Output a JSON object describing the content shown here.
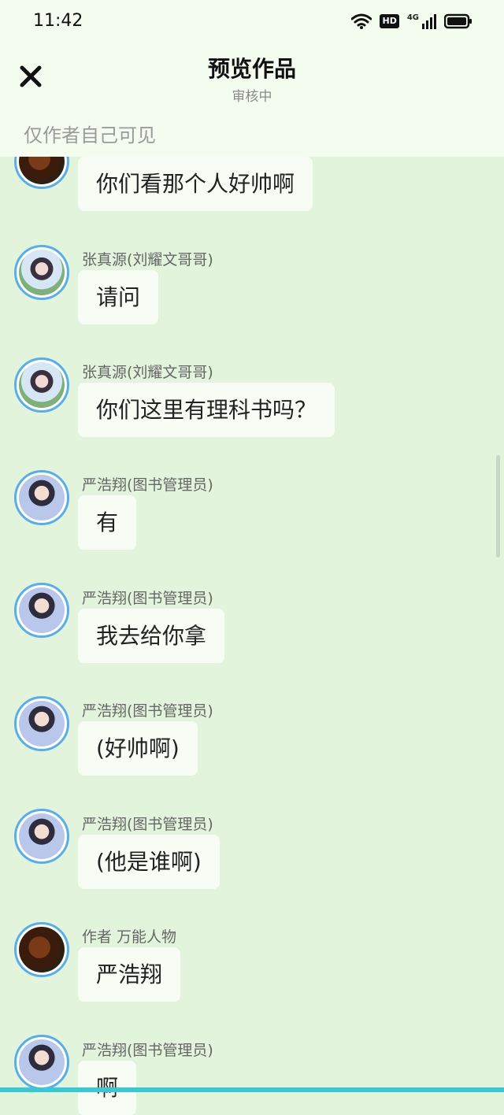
{
  "status_bar": {
    "time": "11:42",
    "icons": [
      "wifi-icon",
      "hd-icon",
      "signal-4g-icon",
      "battery-icon"
    ],
    "hd_label": "HD",
    "network_label": "4G"
  },
  "header": {
    "title": "预览作品",
    "subtitle": "审核中",
    "close_icon": "close-icon",
    "visibility_note": "仅作者自己可见"
  },
  "messages": [
    {
      "name": "",
      "text": "你们看那个人好帅啊",
      "avatar": "food"
    },
    {
      "name": "张真源(刘耀文哥哥)",
      "text": "请问",
      "avatar": "zhang"
    },
    {
      "name": "张真源(刘耀文哥哥)",
      "text": "你们这里有理科书吗？",
      "avatar": "zhang"
    },
    {
      "name": "严浩翔(图书管理员)",
      "text": "有",
      "avatar": "boy"
    },
    {
      "name": "严浩翔(图书管理员)",
      "text": "我去给你拿",
      "avatar": "boy"
    },
    {
      "name": "严浩翔(图书管理员)",
      "text": "(好帅啊)",
      "avatar": "boy"
    },
    {
      "name": "严浩翔(图书管理员)",
      "text": "(他是谁啊)",
      "avatar": "boy"
    },
    {
      "name": "作者 万能人物",
      "text": "严浩翔",
      "avatar": "food"
    },
    {
      "name": "严浩翔(图书管理员)",
      "text": "啊",
      "avatar": "boy"
    }
  ],
  "colors": {
    "background": "#e3f4dd",
    "header_background": "#f4fcf0",
    "bubble": "#f7fdf4",
    "avatar_ring": "#5aaee8",
    "accent_strip": "#39c9d6"
  }
}
